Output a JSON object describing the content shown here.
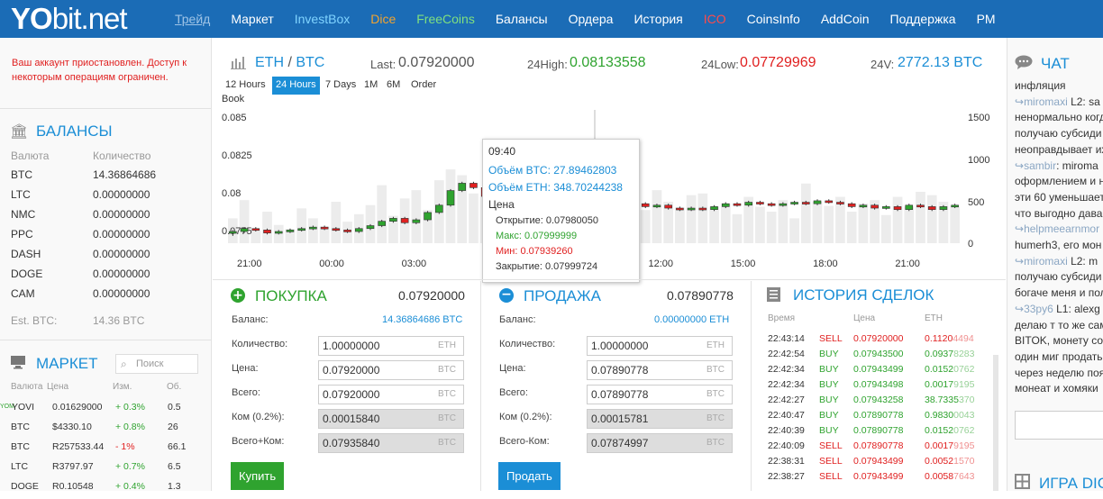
{
  "brand": {
    "logo_bold": "YO",
    "logo_rest": "bit.net"
  },
  "nav": [
    {
      "label": "Трейд",
      "color": "#9fc4e6",
      "underline": true
    },
    {
      "label": "Маркет",
      "color": "#ffffff"
    },
    {
      "label": "InvestBox",
      "color": "#7fd3ff"
    },
    {
      "label": "Dice",
      "color": "#f0a330"
    },
    {
      "label": "FreeCoins",
      "color": "#7fe07f"
    },
    {
      "label": "Балансы",
      "color": "#ffffff"
    },
    {
      "label": "Ордера",
      "color": "#ffffff"
    },
    {
      "label": "История",
      "color": "#ffffff"
    },
    {
      "label": "ICO",
      "color": "#ff4a4a"
    },
    {
      "label": "CoinsInfo",
      "color": "#ffffff"
    },
    {
      "label": "AddCoin",
      "color": "#ffffff"
    },
    {
      "label": "Поддержка",
      "color": "#ffffff"
    },
    {
      "label": "PM",
      "color": "#ffffff"
    }
  ],
  "warning": "Ваш аккаунт приостановлен. Доступ к некоторым операциям ограничен.",
  "balances": {
    "title": "БАЛАНСЫ",
    "col_currency": "Валюта",
    "col_amount": "Количество",
    "rows": [
      {
        "c": "BTC",
        "v": "14.36864686"
      },
      {
        "c": "LTC",
        "v": "0.00000000"
      },
      {
        "c": "NMC",
        "v": "0.00000000"
      },
      {
        "c": "PPC",
        "v": "0.00000000"
      },
      {
        "c": "DASH",
        "v": "0.00000000"
      },
      {
        "c": "DOGE",
        "v": "0.00000000"
      },
      {
        "c": "CAM",
        "v": "0.00000000"
      }
    ],
    "est_label": "Est. BTC:",
    "est_value": "14.36 BTC"
  },
  "market": {
    "title": "МАРКЕТ",
    "search_placeholder": "Поиск",
    "cols": [
      "Валюта",
      "Цена",
      "Изм.",
      "Об."
    ],
    "rows": [
      {
        "c": "YOVI",
        "p": "0.01629000",
        "ch": "+ 0.3%",
        "v": "0.5",
        "up": true,
        "tag": "YOM"
      },
      {
        "c": "BTC",
        "p": "$4330.10",
        "ch": "+ 0.8%",
        "v": "26",
        "up": true,
        "tag": ""
      },
      {
        "c": "BTC",
        "p": "R257533.44",
        "ch": "- 1%",
        "v": "66.1",
        "up": false,
        "tag": ""
      },
      {
        "c": "LTC",
        "p": "R3797.97",
        "ch": "+ 0.7%",
        "v": "6.5",
        "up": true,
        "tag": ""
      },
      {
        "c": "DOGE",
        "p": "R0.10548",
        "ch": "+ 0.4%",
        "v": "1.3",
        "up": true,
        "tag": ""
      }
    ]
  },
  "pair": {
    "base": "ETH",
    "sep": " / ",
    "quote": "BTC"
  },
  "stats": {
    "last_label": "Last:",
    "last": "0.07920000",
    "high_label": "24High:",
    "high": "0.08133558",
    "low_label": "24Low:",
    "low": "0.07729969",
    "vol_label": "24V:",
    "vol": "2772.13 BTC"
  },
  "timeframes": [
    "12 Hours",
    "24 Hours",
    "7 Days",
    "1M",
    "6M",
    "Order"
  ],
  "timeframe_extra": "Book",
  "chart_data": {
    "type": "candlestick",
    "y_ticks": [
      "0.085",
      "0.0825",
      "0.08",
      "0.0775"
    ],
    "ylim": [
      0.0765,
      0.085
    ],
    "vol_ticks": [
      "1500",
      "1000",
      "500",
      "0"
    ],
    "vol_lim": [
      0,
      1500
    ],
    "x_ticks": [
      "21:00",
      "00:00",
      "03:00",
      "06:00",
      "09:00",
      "12:00",
      "15:00",
      "18:00",
      "21:00"
    ],
    "candles": [
      [
        0.0772,
        0.0773,
        0.077,
        0.0774
      ],
      [
        0.0773,
        0.0775,
        0.0772,
        0.0776
      ],
      [
        0.0775,
        0.0774,
        0.0773,
        0.0776
      ],
      [
        0.0774,
        0.0772,
        0.0771,
        0.0775
      ],
      [
        0.0772,
        0.0773,
        0.0771,
        0.0774
      ],
      [
        0.0773,
        0.0774,
        0.0772,
        0.0775
      ],
      [
        0.0774,
        0.0775,
        0.0773,
        0.0776
      ],
      [
        0.0775,
        0.0776,
        0.0774,
        0.0777
      ],
      [
        0.0776,
        0.0775,
        0.0774,
        0.0777
      ],
      [
        0.0775,
        0.0774,
        0.0773,
        0.0776
      ],
      [
        0.0774,
        0.0773,
        0.0772,
        0.0775
      ],
      [
        0.0773,
        0.0775,
        0.0772,
        0.0776
      ],
      [
        0.0775,
        0.0777,
        0.0774,
        0.0778
      ],
      [
        0.0777,
        0.078,
        0.0776,
        0.0781
      ],
      [
        0.078,
        0.0782,
        0.0779,
        0.0783
      ],
      [
        0.0782,
        0.0779,
        0.0778,
        0.0783
      ],
      [
        0.0779,
        0.0781,
        0.0778,
        0.0782
      ],
      [
        0.0781,
        0.0786,
        0.078,
        0.0787
      ],
      [
        0.0786,
        0.0791,
        0.0785,
        0.0792
      ],
      [
        0.0791,
        0.0801,
        0.079,
        0.0802
      ],
      [
        0.0801,
        0.0806,
        0.08,
        0.0807
      ],
      [
        0.0806,
        0.0803,
        0.0802,
        0.0807
      ],
      [
        0.0803,
        0.0797,
        0.0796,
        0.0804
      ],
      [
        0.0797,
        0.0801,
        0.0796,
        0.0802
      ],
      [
        0.0801,
        0.0798,
        0.0797,
        0.0802
      ],
      [
        0.0798,
        0.08,
        0.0797,
        0.0801
      ],
      [
        0.08,
        0.0794,
        0.0793,
        0.0801
      ],
      [
        0.0794,
        0.0797,
        0.0793,
        0.0798
      ],
      [
        0.0797,
        0.0799,
        0.0796,
        0.08
      ],
      [
        0.0799,
        0.0798,
        0.0797,
        0.08
      ],
      [
        0.0798,
        0.0799,
        0.0797,
        0.08
      ],
      [
        0.0799,
        0.0797,
        0.0796,
        0.08
      ],
      [
        0.0797,
        0.0795,
        0.0794,
        0.0798
      ],
      [
        0.0795,
        0.0796,
        0.0794,
        0.0797
      ],
      [
        0.0796,
        0.0794,
        0.0793,
        0.0797
      ],
      [
        0.0794,
        0.0792,
        0.0791,
        0.0795
      ],
      [
        0.0792,
        0.079,
        0.0789,
        0.0793
      ],
      [
        0.079,
        0.0791,
        0.0789,
        0.0792
      ],
      [
        0.0791,
        0.0789,
        0.0788,
        0.0792
      ],
      [
        0.0789,
        0.0788,
        0.0787,
        0.079
      ],
      [
        0.0788,
        0.0789,
        0.0787,
        0.079
      ],
      [
        0.0789,
        0.0788,
        0.0787,
        0.079
      ],
      [
        0.0788,
        0.079,
        0.0787,
        0.0791
      ],
      [
        0.079,
        0.0792,
        0.0789,
        0.0793
      ],
      [
        0.0792,
        0.0791,
        0.079,
        0.0793
      ],
      [
        0.0791,
        0.0793,
        0.079,
        0.0794
      ],
      [
        0.0793,
        0.0792,
        0.0791,
        0.0794
      ],
      [
        0.0792,
        0.0791,
        0.079,
        0.0793
      ],
      [
        0.0791,
        0.0792,
        0.079,
        0.0793
      ],
      [
        0.0792,
        0.0793,
        0.0791,
        0.0794
      ],
      [
        0.0793,
        0.0792,
        0.0791,
        0.0794
      ],
      [
        0.0792,
        0.0794,
        0.0791,
        0.0795
      ],
      [
        0.0794,
        0.0793,
        0.0792,
        0.0795
      ],
      [
        0.0793,
        0.0792,
        0.0791,
        0.0794
      ],
      [
        0.0792,
        0.079,
        0.0789,
        0.0793
      ],
      [
        0.079,
        0.0791,
        0.0789,
        0.0792
      ],
      [
        0.0791,
        0.0789,
        0.0788,
        0.0792
      ],
      [
        0.0789,
        0.079,
        0.0788,
        0.0791
      ],
      [
        0.079,
        0.0788,
        0.0787,
        0.0791
      ],
      [
        0.0788,
        0.0791,
        0.0787,
        0.0792
      ],
      [
        0.0791,
        0.079,
        0.0789,
        0.0792
      ],
      [
        0.079,
        0.0788,
        0.0787,
        0.0791
      ],
      [
        0.0788,
        0.079,
        0.0787,
        0.0791
      ],
      [
        0.079,
        0.0791,
        0.0789,
        0.0792
      ]
    ],
    "volumes": [
      300,
      520,
      150,
      380,
      220,
      170,
      420,
      300,
      200,
      500,
      260,
      350,
      460,
      700,
      330,
      540,
      640,
      400,
      760,
      890,
      820,
      600,
      560,
      700,
      540,
      630,
      540,
      380,
      660,
      470,
      520,
      740,
      620,
      380,
      520,
      460,
      400,
      640,
      500,
      430,
      580,
      600,
      440,
      480,
      350,
      560,
      440,
      380,
      520,
      300,
      720,
      500,
      450,
      560,
      380,
      480,
      520,
      340,
      560,
      440,
      620,
      580,
      500,
      440
    ]
  },
  "tooltip": {
    "time": "09:40",
    "vol_btc": "Объём BTC: 27.89462803",
    "vol_eth": "Объём ETH: 348.70244238",
    "price_label": "Цена",
    "open": "Открытие: 0.07980050",
    "high": "Макс: 0.07999999",
    "low": "Мин: 0.07939260",
    "close": "Закрытие: 0.07999724"
  },
  "buy": {
    "title": "ПОКУПКА",
    "price": "0.07920000",
    "balance_label": "Баланс:",
    "balance": "14.36864686 BTC",
    "qty_label": "Количество:",
    "qty": "1.00000000",
    "qty_unit": "ETH",
    "price_label": "Цена:",
    "price_val": "0.07920000",
    "price_unit": "BTC",
    "total_label": "Всего:",
    "total": "0.07920000",
    "total_unit": "BTC",
    "fee_label": "Ком (0.2%):",
    "fee": "0.00015840",
    "fee_unit": "BTC",
    "gross_label": "Всего+Ком:",
    "gross": "0.07935840",
    "gross_unit": "BTC",
    "button": "Купить"
  },
  "sell": {
    "title": "ПРОДАЖА",
    "price": "0.07890778",
    "balance_label": "Баланс:",
    "balance": "0.00000000 ETH",
    "qty_label": "Количество:",
    "qty": "1.00000000",
    "qty_unit": "ETH",
    "price_label": "Цена:",
    "price_val": "0.07890778",
    "price_unit": "BTC",
    "total_label": "Всего:",
    "total": "0.07890778",
    "total_unit": "BTC",
    "fee_label": "Ком (0.2%):",
    "fee": "0.00015781",
    "fee_unit": "BTC",
    "gross_label": "Всего-Ком:",
    "gross": "0.07874997",
    "gross_unit": "BTC",
    "button": "Продать"
  },
  "history": {
    "title": "ИСТОРИЯ СДЕЛОК",
    "cols": [
      "Время",
      "Цена",
      "ETH"
    ],
    "rows": [
      {
        "t": "22:43:14",
        "s": "SELL",
        "p": "0.07920000",
        "a1": "0.1120",
        "a2": "4494"
      },
      {
        "t": "22:42:54",
        "s": "BUY",
        "p": "0.07943500",
        "a1": "0.0937",
        "a2": "8283"
      },
      {
        "t": "22:42:34",
        "s": "BUY",
        "p": "0.07943499",
        "a1": "0.0152",
        "a2": "0762"
      },
      {
        "t": "22:42:34",
        "s": "BUY",
        "p": "0.07943498",
        "a1": "0.0017",
        "a2": "9195"
      },
      {
        "t": "22:42:27",
        "s": "BUY",
        "p": "0.07943258",
        "a1": "38.7335",
        "a2": "370"
      },
      {
        "t": "22:40:47",
        "s": "BUY",
        "p": "0.07890778",
        "a1": "0.9830",
        "a2": "0043"
      },
      {
        "t": "22:40:39",
        "s": "BUY",
        "p": "0.07890778",
        "a1": "0.0152",
        "a2": "0762"
      },
      {
        "t": "22:40:09",
        "s": "SELL",
        "p": "0.07890778",
        "a1": "0.0017",
        "a2": "9195"
      },
      {
        "t": "22:38:31",
        "s": "SELL",
        "p": "0.07943499",
        "a1": "0.0052",
        "a2": "1570"
      },
      {
        "t": "22:38:27",
        "s": "SELL",
        "p": "0.07943499",
        "a1": "0.0058",
        "a2": "7643"
      }
    ]
  },
  "chat": {
    "title": "ЧАТ",
    "lines": [
      {
        "u": "",
        "t": "инфляция"
      },
      {
        "u": "miromaxi",
        "t": " L2: sa"
      },
      {
        "u": "",
        "t": "ненормально когд"
      },
      {
        "u": "",
        "t": "получаю субсиди"
      },
      {
        "u": "",
        "t": "неоправдывает их"
      },
      {
        "u": "sambir",
        "t": ": miroma"
      },
      {
        "u": "",
        "t": "оформлением и н"
      },
      {
        "u": "",
        "t": "эти 60 уменьшает"
      },
      {
        "u": "",
        "t": "что выгодно дава"
      },
      {
        "u": "helpmeearnmor",
        "t": ""
      },
      {
        "u": "",
        "t": "humerh3, его мон"
      },
      {
        "u": "miromaxi",
        "t": " L2: m"
      },
      {
        "u": "",
        "t": "получаю субсиди"
      },
      {
        "u": "",
        "t": "богаче меня и пол"
      },
      {
        "u": "33py6",
        "t": " L1: alexg"
      },
      {
        "u": "",
        "t": "делаю т то же сам"
      },
      {
        "u": "",
        "t": "BITOK, монету соз"
      },
      {
        "u": "",
        "t": "один миг продать"
      },
      {
        "u": "",
        "t": "через неделю поя"
      },
      {
        "u": "",
        "t": "монеат и хомяки"
      }
    ],
    "game_title": "ИГРА DIC"
  }
}
